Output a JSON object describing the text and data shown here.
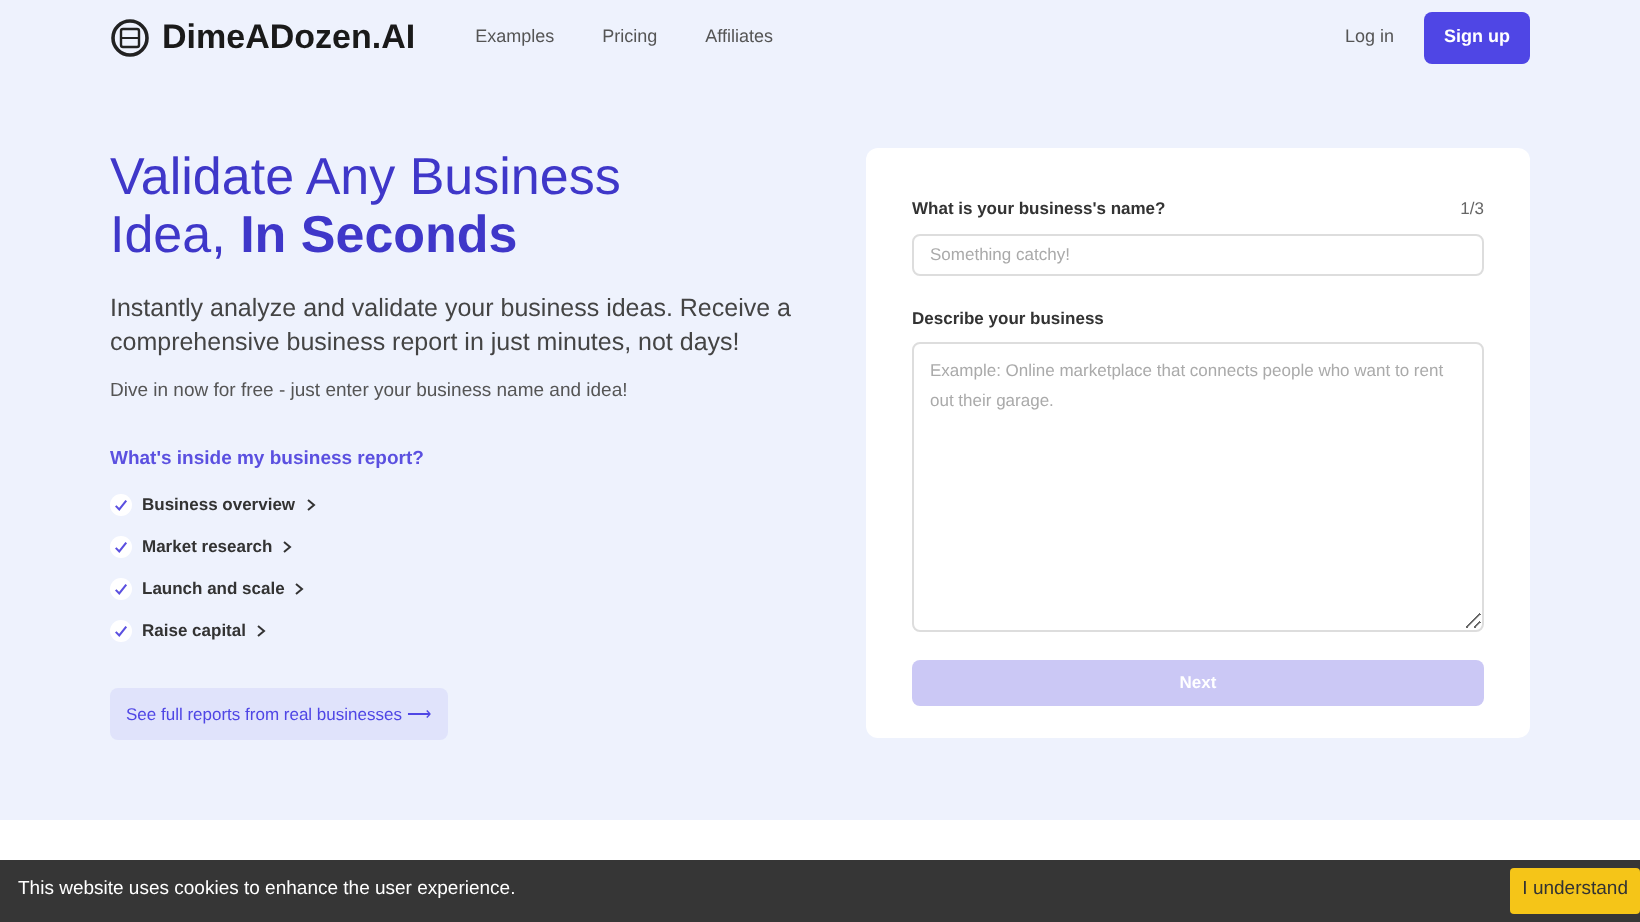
{
  "nav": {
    "brand": "DimeADozen.AI",
    "links": [
      "Examples",
      "Pricing",
      "Affiliates"
    ],
    "login": "Log in",
    "signup": "Sign up"
  },
  "hero": {
    "title_line1": "Validate Any Business",
    "title_line2": "Idea, **In Seconds**",
    "lead": "Instantly analyze and validate your business ideas. Receive a comprehensive business report in just minutes, not days!",
    "sub": "Dive in now for free - just enter your business name and idea!",
    "report_heading": "What's inside my business report?",
    "report_items": [
      {
        "label": "Business overview",
        "checked": true
      },
      {
        "label": "Market research",
        "checked": true
      },
      {
        "label": "Launch and scale",
        "checked": true
      },
      {
        "label": "Raise capital",
        "checked": true
      }
    ],
    "reports_link": "See full reports from real businesses ⟶"
  },
  "form": {
    "name_label": "What is your business's name?",
    "step": "1/3",
    "name_placeholder": "Something catchy!",
    "desc_label": "Describe your business",
    "desc_placeholder": "Example: Online marketplace that connects people who want to rent out their garage.",
    "next": "Next",
    "next_disabled": true
  },
  "cookie": {
    "text": "This website uses cookies to enhance the user experience.",
    "button": "I understand"
  }
}
